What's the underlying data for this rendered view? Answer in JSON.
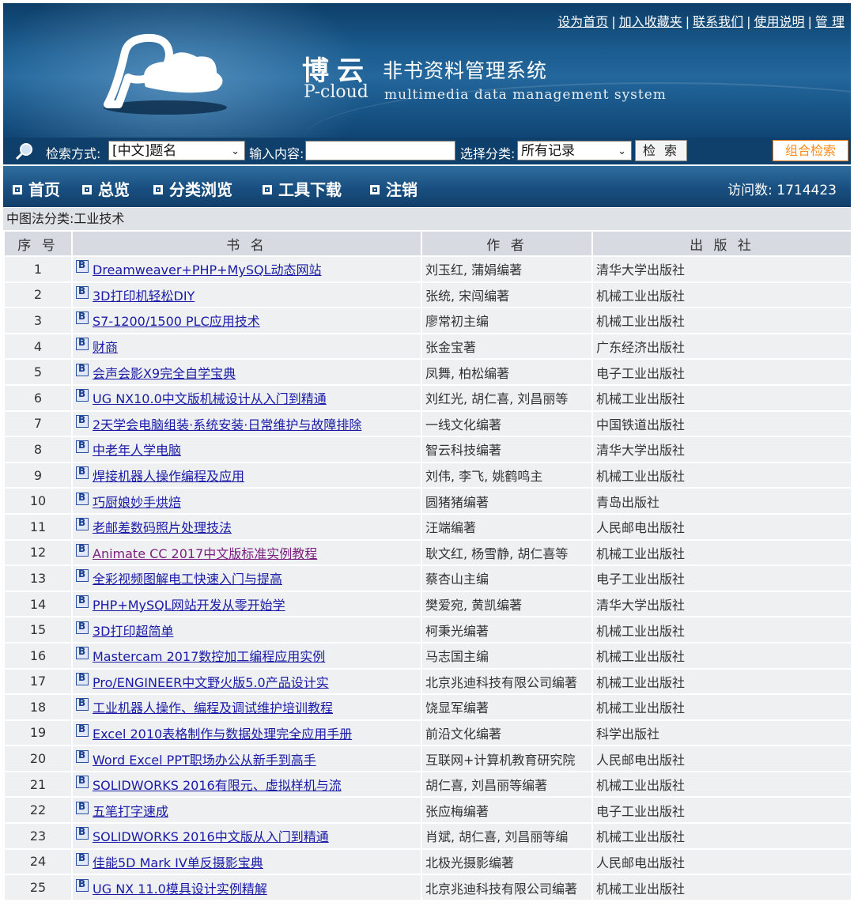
{
  "header": {
    "links": [
      "设为首页",
      "加入收藏夹",
      "联系我们",
      "使用说明",
      "管 理"
    ],
    "brand_cn": "博云",
    "system_cn": "非书资料管理系统",
    "brand_en": "P-cloud",
    "system_en": "multimedia data management system"
  },
  "search": {
    "method_label": "检索方式:",
    "method_value": "[中文]题名",
    "input_label": "输入内容:",
    "input_value": "",
    "category_label": "选择分类:",
    "category_value": "所有记录",
    "search_button": "检 索",
    "combo_button": "组合检索"
  },
  "nav": {
    "items": [
      "首页",
      "总览",
      "分类浏览",
      "工具下载",
      "注销"
    ],
    "visits_label": "访问数:",
    "visits_value": "1714423"
  },
  "breadcrumb": "中图法分类:工业技术",
  "table": {
    "headers": [
      "序 号",
      "书 名",
      "作 者",
      "出 版 社"
    ],
    "rows": [
      {
        "no": "1",
        "title": "Dreamweaver+PHP+MySQL动态网站",
        "author": "刘玉红, 蒲娟编著",
        "publisher": "清华大学出版社"
      },
      {
        "no": "2",
        "title": "3D打印机轻松DIY",
        "author": "张统, 宋闯编著",
        "publisher": "机械工业出版社"
      },
      {
        "no": "3",
        "title": "S7-1200/1500 PLC应用技术",
        "author": "廖常初主编",
        "publisher": "机械工业出版社"
      },
      {
        "no": "4",
        "title": "财商",
        "author": "张金宝著",
        "publisher": "广东经济出版社"
      },
      {
        "no": "5",
        "title": "会声会影X9完全自学宝典",
        "author": "凤舞, 柏松编著",
        "publisher": "电子工业出版社"
      },
      {
        "no": "6",
        "title": "UG NX10.0中文版机械设计从入门到精通",
        "author": "刘红光, 胡仁喜, 刘昌丽等",
        "publisher": "机械工业出版社"
      },
      {
        "no": "7",
        "title": "2天学会电脑组装·系统安装·日常维护与故障排除",
        "author": "一线文化编著",
        "publisher": "中国铁道出版社"
      },
      {
        "no": "8",
        "title": "中老年人学电脑",
        "author": "智云科技编著",
        "publisher": "清华大学出版社"
      },
      {
        "no": "9",
        "title": "焊接机器人操作编程及应用",
        "author": "刘伟, 李飞, 姚鹤鸣主",
        "publisher": "机械工业出版社"
      },
      {
        "no": "10",
        "title": "巧厨娘妙手烘焙",
        "author": "圆猪猪编著",
        "publisher": "青岛出版社"
      },
      {
        "no": "11",
        "title": "老邮差数码照片处理技法",
        "author": "汪端编著",
        "publisher": "人民邮电出版社"
      },
      {
        "no": "12",
        "title": "Animate CC 2017中文版标准实例教程",
        "author": "耿文红, 杨雪静, 胡仁喜等",
        "publisher": "机械工业出版社"
      },
      {
        "no": "13",
        "title": "全彩视频图解电工快速入门与提高",
        "author": "蔡杏山主编",
        "publisher": "电子工业出版社"
      },
      {
        "no": "14",
        "title": "PHP+MySQL网站开发从零开始学",
        "author": "樊爱宛, 黄凯编著",
        "publisher": "清华大学出版社"
      },
      {
        "no": "15",
        "title": "3D打印超简单",
        "author": "柯秉光编著",
        "publisher": "机械工业出版社"
      },
      {
        "no": "16",
        "title": "Mastercam 2017数控加工编程应用实例",
        "author": "马志国主编",
        "publisher": "机械工业出版社"
      },
      {
        "no": "17",
        "title": "Pro/ENGINEER中文野火版5.0产品设计实",
        "author": "北京兆迪科技有限公司编著",
        "publisher": "机械工业出版社"
      },
      {
        "no": "18",
        "title": "工业机器人操作、编程及调试维护培训教程",
        "author": "饶显军编著",
        "publisher": "机械工业出版社"
      },
      {
        "no": "19",
        "title": "Excel 2010表格制作与数据处理完全应用手册",
        "author": "前沿文化编著",
        "publisher": "科学出版社"
      },
      {
        "no": "20",
        "title": "Word Excel PPT职场办公从新手到高手",
        "author": "互联网+计算机教育研究院",
        "publisher": "人民邮电出版社"
      },
      {
        "no": "21",
        "title": "SOLIDWORKS 2016有限元、虚拟样机与流",
        "author": "胡仁喜, 刘昌丽等编著",
        "publisher": "机械工业出版社"
      },
      {
        "no": "22",
        "title": "五笔打字速成",
        "author": "张应梅编著",
        "publisher": "电子工业出版社"
      },
      {
        "no": "23",
        "title": "SOLIDWORKS 2016中文版从入门到精通",
        "author": "肖斌, 胡仁喜, 刘昌丽等编",
        "publisher": "机械工业出版社"
      },
      {
        "no": "24",
        "title": "佳能5D Mark IV单反摄影宝典",
        "author": "北极光摄影编著",
        "publisher": "人民邮电出版社"
      },
      {
        "no": "25",
        "title": "UG NX 11.0模具设计实例精解",
        "author": "北京兆迪科技有限公司编著",
        "publisher": "机械工业出版社"
      }
    ]
  },
  "colors": {
    "banner_dark": "#0d3e68",
    "nav_blue": "#184f80",
    "link_blue": "#1a1aa6",
    "visited_purple": "#7a1d7e",
    "combo_orange": "#ff8c1a",
    "row_bg": "#eef0f2",
    "header_bg": "#d7dbe1"
  },
  "icons": {
    "search": "magnifier-icon",
    "nav": "square-bullet-icon",
    "book": "book-b-icon"
  }
}
